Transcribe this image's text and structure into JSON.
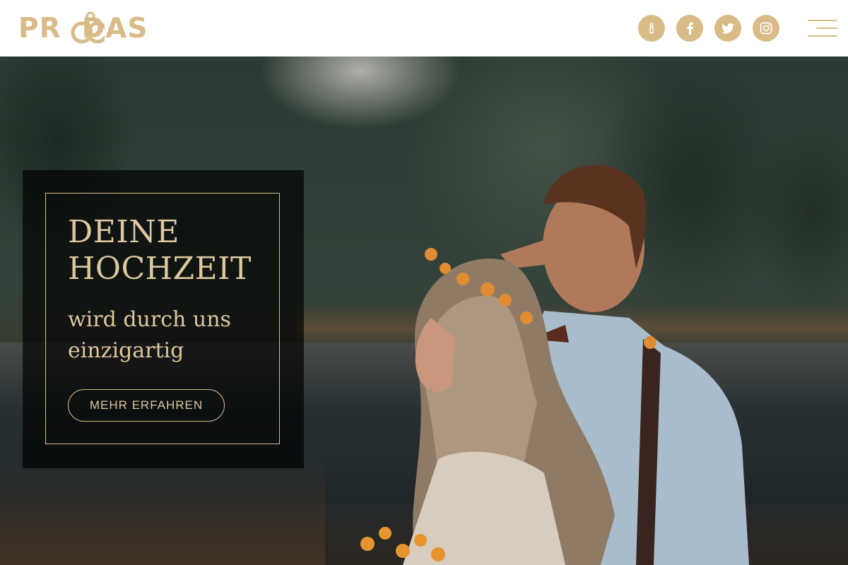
{
  "header": {
    "logo_text": "PR  DAS",
    "brand_color": "#d8bb87",
    "social_icons": [
      {
        "name": "info-icon"
      },
      {
        "name": "facebook-icon"
      },
      {
        "name": "twitter-icon"
      },
      {
        "name": "instagram-icon"
      }
    ],
    "menu_icon": "hamburger-menu-icon"
  },
  "hero": {
    "headline": [
      "DEINE",
      "HOCHZEIT"
    ],
    "subline": [
      "wird durch uns",
      "einzigartig"
    ],
    "cta_label": "MEHR ERFAHREN",
    "accent_color": "#ddc79e",
    "background_description_color": "#2b3a33"
  }
}
